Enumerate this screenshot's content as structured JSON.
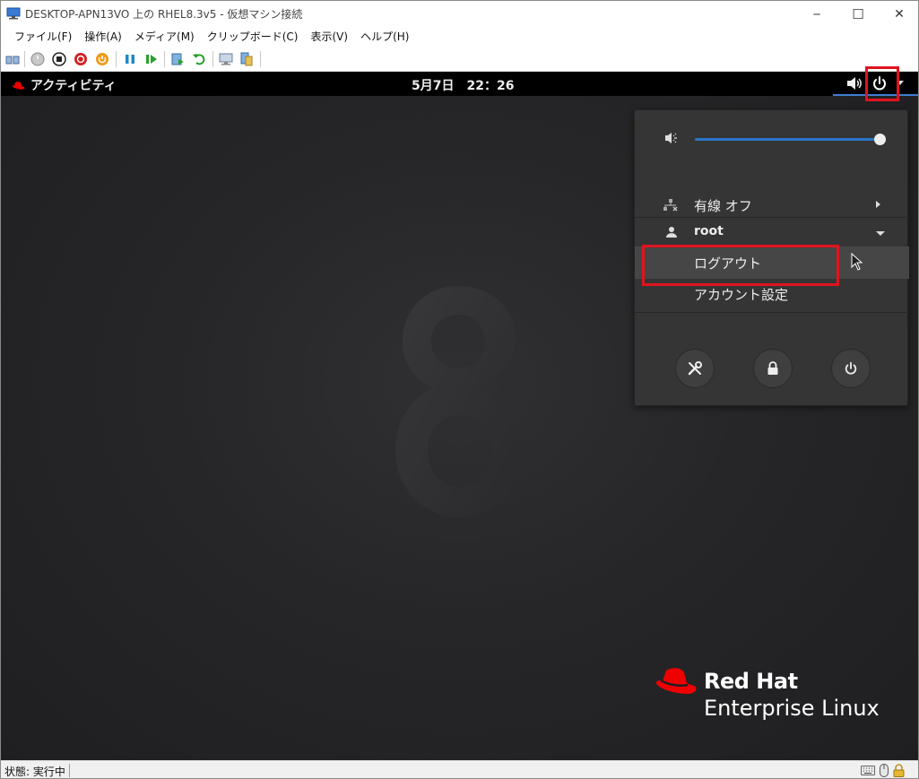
{
  "window": {
    "title": "DESKTOP-APN13VO 上の RHEL8.3v5 - 仮想マシン接続",
    "minimize_label": "─",
    "maximize_label": "☐",
    "close_label": "✕"
  },
  "menubar": {
    "items": [
      "ファイル(F)",
      "操作(A)",
      "メディア(M)",
      "クリップボード(C)",
      "表示(V)",
      "ヘルプ(H)"
    ]
  },
  "gnome": {
    "activities_label": "アクティビティ",
    "clock": "5月7日　22：26"
  },
  "popup": {
    "volume_level": 1.0,
    "network_label": "有線 オフ",
    "user_label": "root",
    "logout_label": "ログアウト",
    "account_settings_label": "アカウント設定"
  },
  "brand": {
    "line1": "Red Hat",
    "line2": "Enterprise Linux"
  },
  "statusbar": {
    "text": "状態: 実行中"
  },
  "colors": {
    "highlight": "#e0141e",
    "redhat_red": "#ee0000",
    "accent_blue": "#2a76c6"
  }
}
